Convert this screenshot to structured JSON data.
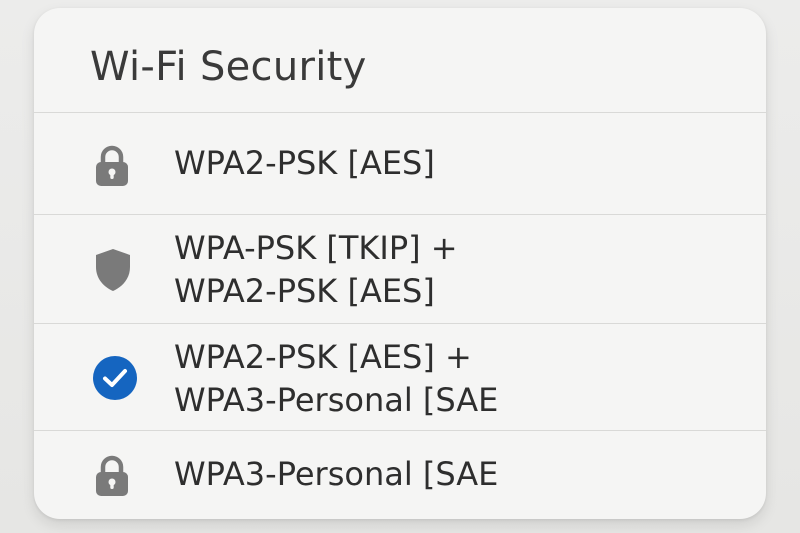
{
  "title": "Wi-Fi Security",
  "options": [
    {
      "icon": "lock-icon",
      "lines": [
        "WPA2-PSK [AES]"
      ],
      "selected": false
    },
    {
      "icon": "shield-icon",
      "lines": [
        "WPA-PSK [TKIP] +",
        "WPA2-PSK [AES]"
      ],
      "selected": false
    },
    {
      "icon": "checkmark-icon",
      "lines": [
        "WPA2-PSK [AES] +",
        "WPA3-Personal [SAE"
      ],
      "selected": true
    },
    {
      "icon": "lock-icon",
      "lines": [
        "WPA3-Personal [SAE"
      ],
      "selected": false
    }
  ],
  "colors": {
    "accent": "#1565c0",
    "icon_gray": "#7a7a7a"
  }
}
